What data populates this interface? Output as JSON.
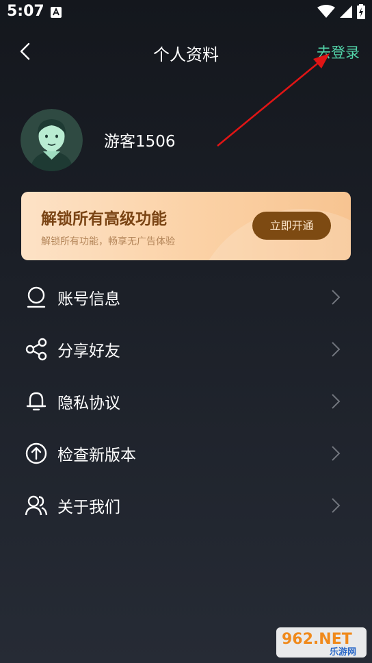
{
  "status_bar": {
    "time": "5:07"
  },
  "header": {
    "title": "个人资料",
    "login_label": "去登录"
  },
  "profile": {
    "username": "游客1506"
  },
  "vip_card": {
    "title": "解锁所有高级功能",
    "subtitle": "解锁所有功能，畅享无广告体验",
    "button_label": "立即开通"
  },
  "menu": {
    "items": [
      {
        "label": "账号信息",
        "icon": "user-icon"
      },
      {
        "label": "分享好友",
        "icon": "share-icon"
      },
      {
        "label": "隐私协议",
        "icon": "bell-icon"
      },
      {
        "label": "检查新版本",
        "icon": "upload-icon"
      },
      {
        "label": "关于我们",
        "icon": "users-icon"
      }
    ]
  },
  "watermark": {
    "brand": "962.NET",
    "sub": "乐游网"
  },
  "colors": {
    "accent": "#52d3a8",
    "vip_button": "#7d4a12",
    "annotation": "#e01515"
  }
}
